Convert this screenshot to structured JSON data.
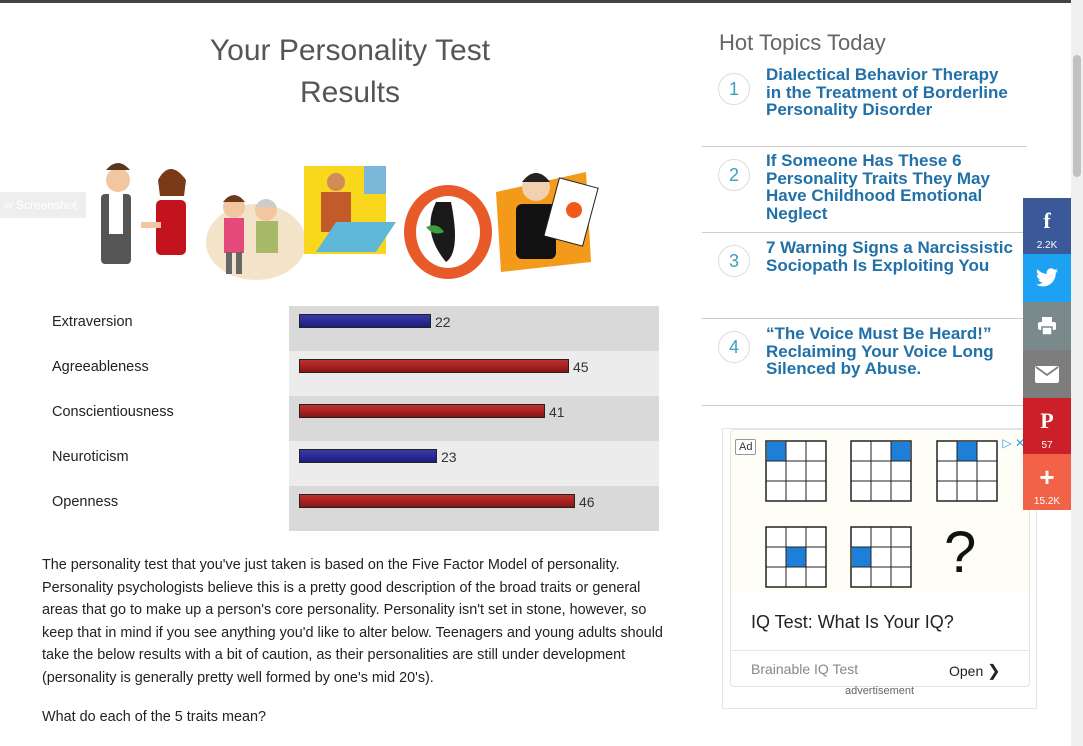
{
  "page": {
    "title_line1": "Your Personality Test",
    "title_line2": "Results",
    "ghost_label": "w Screenshot"
  },
  "traits": [
    {
      "name": "Extraversion",
      "value": 22,
      "color": "#1f1f8a"
    },
    {
      "name": "Agreeableness",
      "value": 45,
      "color": "#9a1a1a"
    },
    {
      "name": "Conscientiousness",
      "value": 41,
      "color": "#9a1a1a"
    },
    {
      "name": "Neuroticism",
      "value": 23,
      "color": "#1f1f8a"
    },
    {
      "name": "Openness",
      "value": 46,
      "color": "#9a1a1a"
    }
  ],
  "article": {
    "paragraph": "The personality test that you've just taken is based on the Five Factor Model of personality. Personality psychologists believe this is a pretty good description of the broad traits or general areas that go to make up a person's core personality. Personality isn't set in stone, however, so keep that in mind if you see anything you'd like to alter below. Teenagers and young adults should take the below results with a bit of caution, as their personalities are still under development (personality is generally pretty well formed by one's mid 20's).",
    "question": "What do each of the 5 traits mean?"
  },
  "hot_topics": {
    "heading": "Hot Topics Today",
    "items": [
      {
        "num": "1",
        "text": "Dialectical Behavior Therapy in the Treatment of Borderline Personality Disorder"
      },
      {
        "num": "2",
        "text": "If Someone Has These 6 Personality Traits They May Have Childhood Emotional Neglect"
      },
      {
        "num": "3",
        "text": "7 Warning Signs a Narcissistic Sociopath Is Exploiting You"
      },
      {
        "num": "4",
        "text": "“The Voice Must Be Heard!” Reclaiming Your Voice Long Silenced by Abuse."
      }
    ]
  },
  "ad": {
    "badge": "Ad",
    "headline": "IQ Test: What Is Your IQ?",
    "sponsor": "Brainable IQ Test",
    "cta": "Open",
    "label": "advertisement",
    "question_mark": "?"
  },
  "share": {
    "facebook": {
      "icon": "f",
      "count": "2.2K",
      "color": "#3b5998"
    },
    "twitter": {
      "icon": "twitter-bird",
      "color": "#1da1f2"
    },
    "print": {
      "icon": "printer",
      "color": "#7a8a8a"
    },
    "email": {
      "icon": "envelope",
      "color": "#7d7d7d"
    },
    "pinterest": {
      "icon": "P",
      "count": "57",
      "color": "#cb2027"
    },
    "more": {
      "icon": "+",
      "count": "15.2K",
      "color": "#f26249"
    }
  }
}
